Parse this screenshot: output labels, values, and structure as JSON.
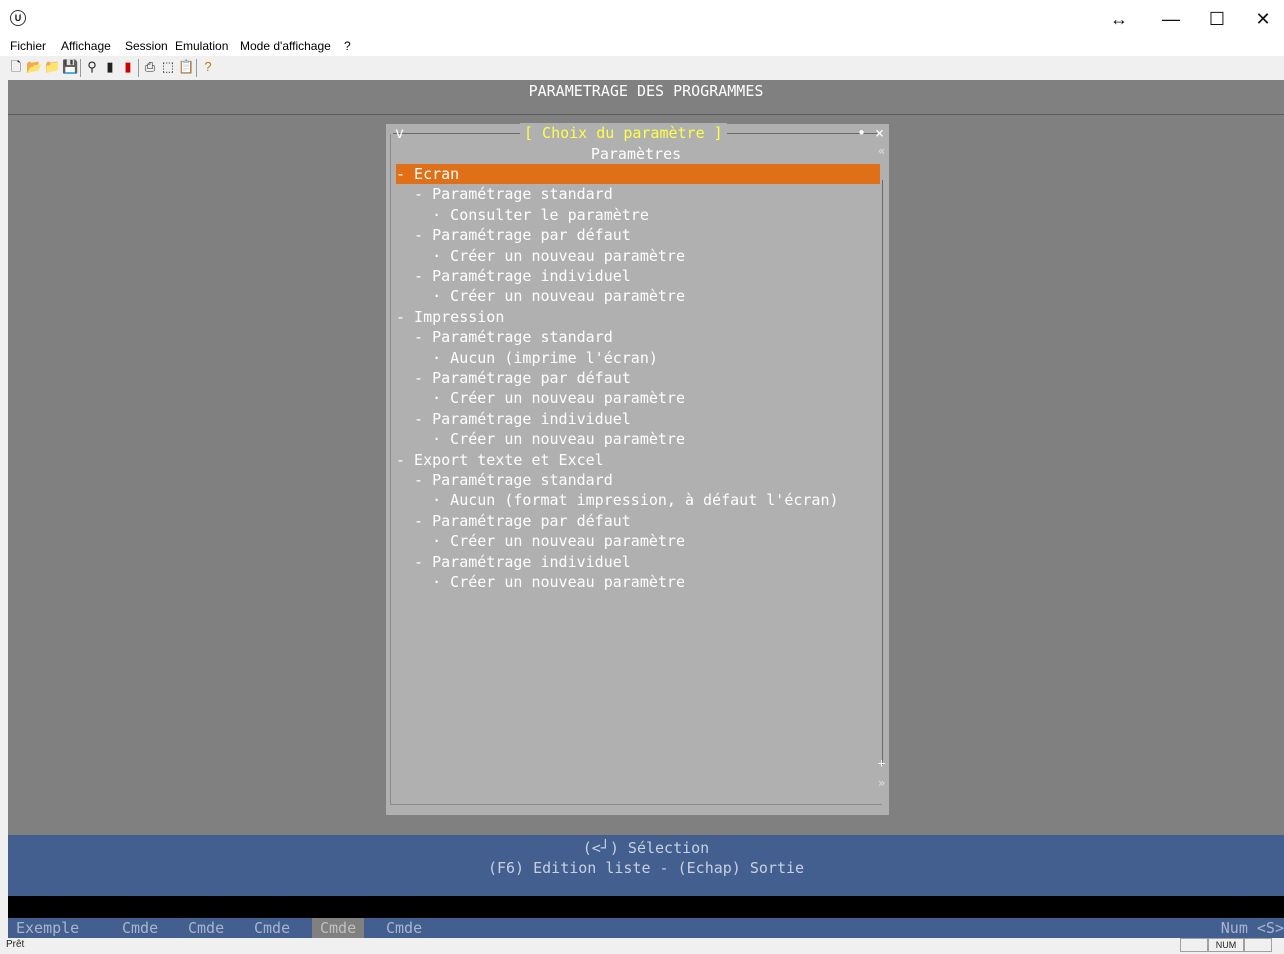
{
  "window": {
    "app_icon": "U",
    "resize_icon": "↔",
    "minimize": "—",
    "maximize": "☐",
    "close": "✕"
  },
  "menu": [
    "Fichier",
    "Affichage",
    "Session",
    "Emulation",
    "Mode d'affichage",
    "?"
  ],
  "toolbar_icons": [
    "new-icon",
    "open-icon",
    "open-session-icon",
    "save-icon",
    "search-icon",
    "bookmark-icon",
    "traffic-light-icon",
    "print-icon",
    "capture-icon",
    "paste-icon",
    "help-icon"
  ],
  "header": {
    "title": "PARAMETRAGE DES PROGRAMMES"
  },
  "dialog": {
    "left_mark": "v",
    "title": "[ Choix du paramètre ]",
    "right_mark": "• ×",
    "heading": "Paramètres",
    "scroll_top": "«",
    "scroll_plus": "+",
    "scroll_bottom": "»",
    "items": [
      "- Ecran",
      "  - Paramétrage standard",
      "    · Consulter le paramètre",
      "  - Paramétrage par défaut",
      "    · Créer un nouveau paramètre",
      "  - Paramétrage individuel",
      "    · Créer un nouveau paramètre",
      "- Impression",
      "  - Paramétrage standard",
      "    · Aucun (imprime l'écran)",
      "  - Paramétrage par défaut",
      "    · Créer un nouveau paramètre",
      "  - Paramétrage individuel",
      "    · Créer un nouveau paramètre",
      "- Export texte et Excel",
      "  - Paramétrage standard",
      "    · Aucun (format impression, à défaut l'écran)",
      "  - Paramétrage par défaut",
      "    · Créer un nouveau paramètre",
      "  - Paramétrage individuel",
      "    · Créer un nouveau paramètre"
    ],
    "selected_index": 0
  },
  "footer": {
    "line1": "(<┘) Sélection",
    "line2": "(F6) Edition liste - (Echap) Sortie"
  },
  "fkeys": [
    "Exemple",
    "Cmde",
    "Cmde",
    "Cmde",
    "Cmde",
    "Cmde"
  ],
  "fkeys_active_index": 4,
  "fkeys_right": "Num <S>",
  "status": {
    "left": "Prêt",
    "box_num": "NUM"
  },
  "colors": {
    "terminal_bg": "#808080",
    "dialog_bg": "#b0b0b0",
    "selection": "#e07018",
    "title_yellow": "#ffff44",
    "footer_blue": "#435f8f"
  }
}
